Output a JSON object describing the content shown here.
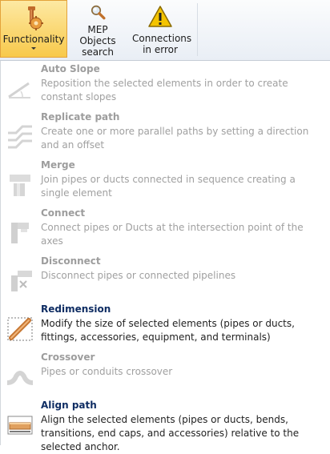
{
  "ribbon": {
    "buttons": [
      {
        "label": "Functionality",
        "icon": "wrench-gear-icon",
        "active": true
      },
      {
        "label": "MEP Objects search",
        "icon": "magnifier-icon",
        "active": false
      },
      {
        "label": "Connections in error",
        "icon": "warning-icon",
        "active": false
      }
    ]
  },
  "menu": {
    "items": [
      {
        "title": "Auto Slope",
        "description": "Reposition the selected elements in order to create constant slopes",
        "enabled": false,
        "icon": "slope-icon"
      },
      {
        "title": "Replicate path",
        "description": "Create one or more parallel paths by setting a direction and an offset",
        "enabled": false,
        "icon": "replicate-path-icon"
      },
      {
        "title": "Merge",
        "description": "Join pipes or ducts connected in sequence creating a single element",
        "enabled": false,
        "icon": "merge-icon"
      },
      {
        "title": "Connect",
        "description": "Connect pipes or Ducts at the intersection point of the axes",
        "enabled": false,
        "icon": "connect-icon"
      },
      {
        "title": "Disconnect",
        "description": "Disconnect pipes or connected pipelines",
        "enabled": false,
        "icon": "disconnect-icon"
      },
      {
        "title": "Redimension",
        "description": "Modify the size of selected elements (pipes or ducts, fittings, accessories, equipment, and terminals)",
        "enabled": true,
        "icon": "redimension-icon"
      },
      {
        "title": "Crossover",
        "description": "Pipes or conduits crossover",
        "enabled": false,
        "icon": "crossover-icon"
      },
      {
        "title": "Align path",
        "description": "Align the selected elements (pipes or ducts, bends, transitions, end caps, and accessories) relative to the selected anchor.",
        "enabled": true,
        "icon": "align-path-icon"
      }
    ]
  }
}
